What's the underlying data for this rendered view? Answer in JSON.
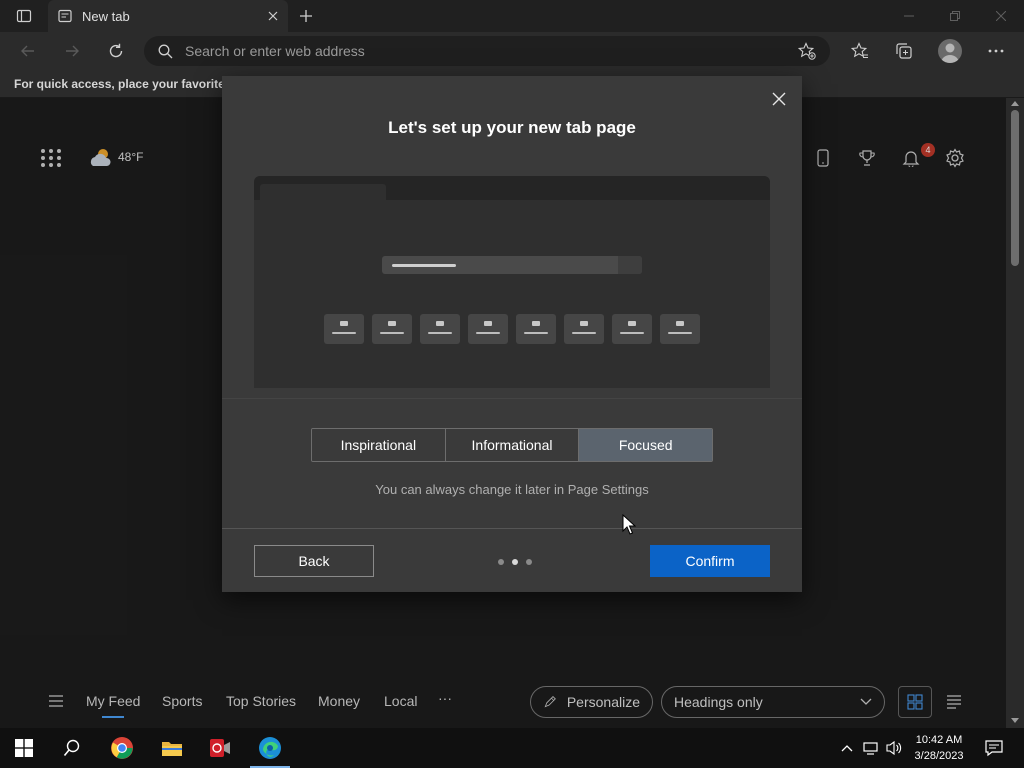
{
  "browser": {
    "tab_title": "New tab",
    "address_placeholder": "Search or enter web address",
    "favorites_hint": "For quick access, place your favorites h"
  },
  "page": {
    "weather_temp": "48°F",
    "notification_count": "4"
  },
  "modal": {
    "title": "Let's set up your new tab page",
    "options": [
      {
        "label": "Inspirational",
        "selected": false
      },
      {
        "label": "Informational",
        "selected": false
      },
      {
        "label": "Focused",
        "selected": true
      }
    ],
    "hint": "You can always change it later in Page Settings",
    "back_label": "Back",
    "confirm_label": "Confirm",
    "pager_active_index": 1,
    "pager_count": 3
  },
  "feed": {
    "items": [
      "My Feed",
      "Sports",
      "Top Stories",
      "Money",
      "Local"
    ],
    "more": "···",
    "personalize_label": "Personalize",
    "heading_select_value": "Headings only"
  },
  "taskbar": {
    "time": "10:42 AM",
    "date": "3/28/2023"
  },
  "colors": {
    "accent": "#0b63c7",
    "selected_segment": "#5b646e",
    "badge": "#c0392b"
  }
}
